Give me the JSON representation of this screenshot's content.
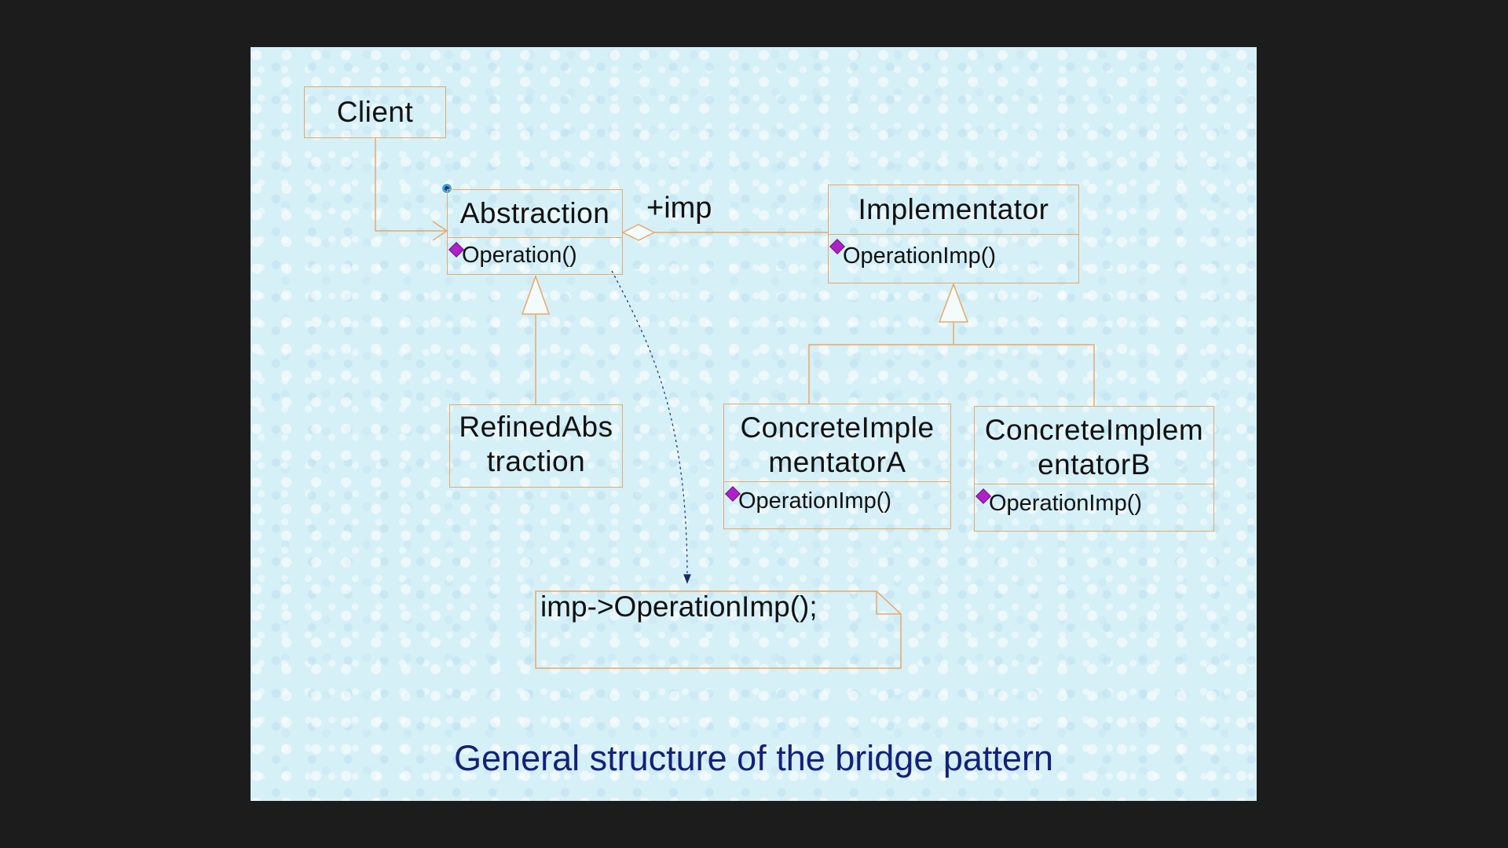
{
  "colors": {
    "background": "#1c1c1c",
    "slide": "#d6f0f7",
    "class_border": "#e8a868",
    "operation_icon": "#b020c8",
    "dependency_line": "#1a2a6a",
    "caption": "#14207a"
  },
  "diagram": {
    "classes": {
      "client": {
        "name": "Client"
      },
      "abstraction": {
        "name": "Abstraction",
        "operations": [
          "Operation()"
        ]
      },
      "implementor": {
        "name": "Implementator",
        "operations": [
          "OperationImp()"
        ]
      },
      "refined": {
        "name_line1": "RefinedAbs",
        "name_line2": "traction"
      },
      "concrete_a": {
        "name_line1": "ConcreteImple",
        "name_line2": "mentatorA",
        "operations": [
          "OperationImp()"
        ]
      },
      "concrete_b": {
        "name_line1": "ConcreteImplem",
        "name_line2": "entatorB",
        "operations": [
          "OperationImp()"
        ]
      }
    },
    "association_label": "+imp",
    "note": "imp->OperationImp();",
    "operation_icon": "method-diamond-icon"
  },
  "caption": "General structure of the bridge pattern"
}
